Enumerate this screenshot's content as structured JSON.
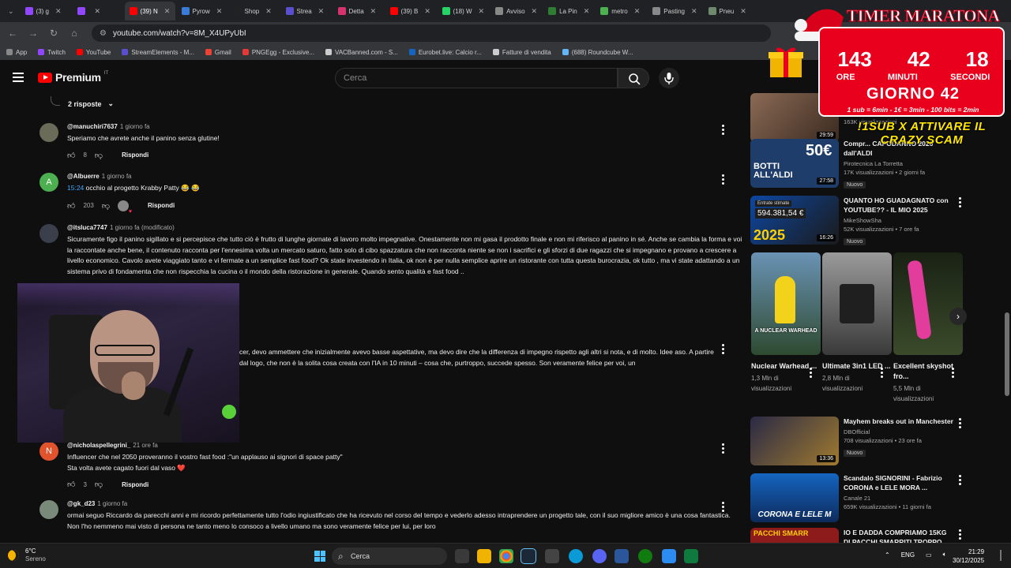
{
  "browser": {
    "tabs": [
      {
        "label": "(3) g",
        "color": "#9146ff",
        "active": false
      },
      {
        "label": "",
        "color": "#9146ff",
        "active": false
      },
      {
        "label": "(39) N",
        "color": "#ff0000",
        "active": true
      },
      {
        "label": "Pyrow",
        "color": "#3a7bd5",
        "active": false
      },
      {
        "label": "Shop",
        "color": "#222222",
        "active": false
      },
      {
        "label": "Strea",
        "color": "#5a4fcf",
        "active": false
      },
      {
        "label": "Detta",
        "color": "#d6336c",
        "active": false
      },
      {
        "label": "(39) B",
        "color": "#ff0000",
        "active": false
      },
      {
        "label": "(18) W",
        "color": "#25d366",
        "active": false
      },
      {
        "label": "Avviso",
        "color": "#888888",
        "active": false
      },
      {
        "label": "La Pin",
        "color": "#2e7d32",
        "active": false
      },
      {
        "label": "metro",
        "color": "#4caf50",
        "active": false
      },
      {
        "label": "Pasting",
        "color": "#888888",
        "active": false
      },
      {
        "label": "Pneu",
        "color": "#6d8a6d",
        "active": false
      }
    ],
    "url": "youtube.com/watch?v=8M_X4UPyUbI",
    "bookmarks": [
      {
        "label": "App",
        "color": "#888888"
      },
      {
        "label": "Twitch",
        "color": "#9146ff"
      },
      {
        "label": "YouTube",
        "color": "#ff0000"
      },
      {
        "label": "StreamElements - M...",
        "color": "#5a4fcf"
      },
      {
        "label": "Gmail",
        "color": "#ea4335"
      },
      {
        "label": "PNGEgg - Exclusive...",
        "color": "#e53935"
      },
      {
        "label": "VACBanned.com - S...",
        "color": "#cccccc"
      },
      {
        "label": "Eurobet.live: Calcio r...",
        "color": "#1565c0"
      },
      {
        "label": "Fatture di vendita",
        "color": "#cccccc"
      },
      {
        "label": "(688) Roundcube W...",
        "color": "#64b5f6"
      }
    ]
  },
  "youtube": {
    "logo_text": "Premium",
    "logo_country": "IT",
    "search_placeholder": "Cerca"
  },
  "comments": {
    "replies_toggle": "2 risposte",
    "items": [
      {
        "author": "@manuchiri7637",
        "time": "1 giorno fa",
        "text": "Speriamo che avrete anche il panino senza glutine!",
        "likes": "8",
        "reply_label": "Rispondi",
        "avatar_color": "#6b6b5a",
        "avatar_letter": ""
      },
      {
        "author": "@Albuerre",
        "time": "1 giorno fa",
        "timestamp_link": "15:24",
        "text": " occhio al progetto Krabby Patty 😂 😂",
        "likes": "203",
        "reply_label": "Rispondi",
        "avatar_color": "#4caf50",
        "avatar_letter": "A"
      },
      {
        "author": "@itsluca7747",
        "time": "1 giorno fa (modificato)",
        "text": "Sicuramente figo il panino sigillato e si percepisce che tutto ciò è frutto di lunghe giornate di lavoro molto impegnative. Onestamente non mi gasa il prodotto finale e non mi riferisco al panino in sé. Anche se cambia la forma e voi la raccontate anche bene, il contenuto racconta per l'ennesima volta un mercato saturo, fatto solo di cibo spazzatura che non racconta niente se non i sacrifici e gli sforzi di due ragazzi che si impegnano e provano a crescere a livello economico. Cavolo avete viaggiato tanto e vi fermate a un semplice fast food? Ok state investendo in Italia, ok non è per nulla semplice aprire un ristorante con tutta questa burocrazia, ok tutto , ma vi state  adattando  a un sistema privo di fondamenta che non rispecchia la cucina o il  mondo della ristorazione in generale. Quando sento qualità e fast food ..",
        "avatar_color": "#3a3f4b",
        "avatar_letter": ""
      },
      {
        "author": "",
        "time": "",
        "text": "cer, devo ammettere che inizialmente avevo basse aspettative, ma devo dire che la differenza di impegno rispetto agli altri si nota, e di molto. Idee aso. A partire dal logo, che non è la solita cosa creata con l'IA in 10 minuti – cosa che, purtroppo, succede spesso. Son veramente felice per voi, un",
        "avatar_color": "#333333",
        "avatar_letter": ""
      },
      {
        "author": "@nicholaspellegrini_",
        "time": "21 ore fa",
        "text": "Influencer che nel 2050 proveranno il vostro fast food :\"un applauso ai signori di space patty\"",
        "text2": "Sta volta avete cagato fuori dal vaso ❤️",
        "likes": "3",
        "reply_label": "Rispondi",
        "avatar_color": "#e0532c",
        "avatar_letter": "N"
      },
      {
        "author": "@gk_d23",
        "time": "1 giorno fa",
        "text": "ormai seguo Riccardo da parecchi anni e mi ricordo perfettamente tutto l'odio ingiustificato che ha ricevuto nel corso del tempo e vederlo adesso intraprendere un progetto tale, con il suo migliore amico è una cosa fantastica. Non l'ho nemmeno mai visto di persona ne tanto meno lo consoco a livello umano ma sono veramente felice per lui, per loro",
        "avatar_color": "#7a8a7a",
        "avatar_letter": ""
      }
    ]
  },
  "sidebar": {
    "videos_top": [
      {
        "title": "",
        "channel": "",
        "views": "163K visualizzazioni",
        "duration": "29:59",
        "color": "#6a5040",
        "badge": ""
      },
      {
        "title": "Compr... CAPODANNO 2026 dall'ALDI",
        "channel": "Pirotecnica La Torretta",
        "views": "17K visualizzazioni • 2 giorni fa",
        "duration": "27:58",
        "color": "#1f3d6b",
        "badge": "Nuovo",
        "thumb_text": "BOTTI ALL'ALDI",
        "thumb_price": "50€"
      },
      {
        "title": "QUANTO HO GUADAGNATO con YOUTUBE?? - IL MIO 2025",
        "channel": "MikeShowSha",
        "views": "52K visualizzazioni • 7 ore fa",
        "duration": "16:26",
        "color": "#0d47a1",
        "badge": "Nuovo",
        "thumb_text": "594.381,54 €",
        "thumb_sub": "Entrate stimate",
        "thumb_year": "2025"
      }
    ],
    "shorts": [
      {
        "title": "Nuclear Warhead ...",
        "views": "1,3 Mln di visualizzazioni",
        "color": "#3d6a8a",
        "caption": "A NUCLEAR WARHEAD"
      },
      {
        "title": "Ultimate 3in1 LED ...",
        "views": "2,8 Mln di visualizzazioni",
        "color": "#5a5a5a",
        "caption": ""
      },
      {
        "title": "Excellent skyshot fro...",
        "views": "5,5 Mln di visualizzazioni",
        "color": "#2a3a1f",
        "caption": ""
      }
    ],
    "videos_bottom": [
      {
        "title": "Mayhem breaks out in Manchester",
        "channel": "DBOfficial",
        "views": "708 visualizzazioni • 23 ore fa",
        "duration": "13:36",
        "color": "#3a3a55",
        "badge": "Nuovo"
      },
      {
        "title": "Scandalo SIGNORINI - Fabrizio CORONA e LELE MORA ...",
        "channel": "Canale 21",
        "views": "659K visualizzazioni • 11 giorni fa",
        "duration": "",
        "color": "#1565c0",
        "badge": "",
        "thumb_text": "CORONA E LELE M"
      },
      {
        "title": "IO E DADDA COMPRIAMO 15KG DI PACCHI SMARRITI TROPPO",
        "channel": "",
        "views": "",
        "duration": "",
        "color": "#8e1b1b",
        "badge": "",
        "thumb_text": "PACCHI SMARR"
      }
    ]
  },
  "overlay": {
    "timer_title": "TIMER MARATONA",
    "hours": "143",
    "minutes": "42",
    "seconds": "18",
    "hours_label": "ORE",
    "minutes_label": "MINUTI",
    "seconds_label": "SECONDI",
    "day": "GIORNO 42",
    "rates": "1 sub = 6min - 1€ = 3min - 100 bits = 2min",
    "scam_text": "!1SUB X ATTIVARE IL CRAZY SCAM"
  },
  "taskbar": {
    "temp": "6°C",
    "weather": "Sereno",
    "search": "Cerca",
    "lang": "ENG",
    "time": "21:29",
    "date": "30/12/2025"
  }
}
